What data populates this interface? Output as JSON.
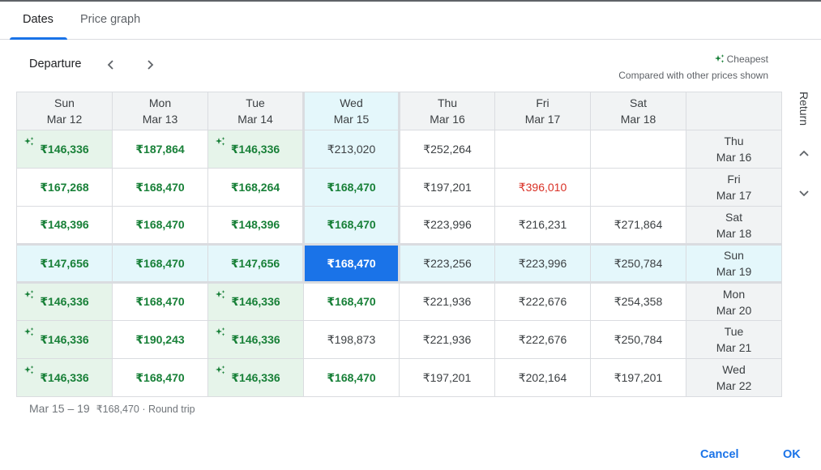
{
  "tabs": [
    {
      "label": "Dates",
      "active": true
    },
    {
      "label": "Price graph",
      "active": false
    }
  ],
  "departure_label": "Departure",
  "legend": {
    "cheapest_label": "Cheapest",
    "note": "Compared with other prices shown",
    "icon": "sparkle-icon",
    "color": "#188038"
  },
  "return_label": "Return",
  "columns": [
    {
      "day": "Sun",
      "date": "Mar 12"
    },
    {
      "day": "Mon",
      "date": "Mar 13"
    },
    {
      "day": "Tue",
      "date": "Mar 14"
    },
    {
      "day": "Wed",
      "date": "Mar 15"
    },
    {
      "day": "Thu",
      "date": "Mar 16"
    },
    {
      "day": "Fri",
      "date": "Mar 17"
    },
    {
      "day": "Sat",
      "date": "Mar 18"
    }
  ],
  "rows": [
    {
      "day": "Thu",
      "date": "Mar 16",
      "cells": [
        {
          "price": "₹146,336",
          "style": "green",
          "cheapest": true
        },
        {
          "price": "₹187,864",
          "style": "green"
        },
        {
          "price": "₹146,336",
          "style": "green",
          "cheapest": true
        },
        {
          "price": "₹213,020",
          "style": "normal"
        },
        {
          "price": "₹252,264",
          "style": "normal"
        },
        {
          "price": "",
          "style": "normal"
        },
        {
          "price": "",
          "style": "normal"
        }
      ]
    },
    {
      "day": "Fri",
      "date": "Mar 17",
      "cells": [
        {
          "price": "₹167,268",
          "style": "green"
        },
        {
          "price": "₹168,470",
          "style": "green"
        },
        {
          "price": "₹168,264",
          "style": "green"
        },
        {
          "price": "₹168,470",
          "style": "green"
        },
        {
          "price": "₹197,201",
          "style": "normal"
        },
        {
          "price": "₹396,010",
          "style": "red"
        },
        {
          "price": "",
          "style": "normal"
        }
      ]
    },
    {
      "day": "Sat",
      "date": "Mar 18",
      "cells": [
        {
          "price": "₹148,396",
          "style": "green"
        },
        {
          "price": "₹168,470",
          "style": "green"
        },
        {
          "price": "₹148,396",
          "style": "green"
        },
        {
          "price": "₹168,470",
          "style": "green"
        },
        {
          "price": "₹223,996",
          "style": "normal"
        },
        {
          "price": "₹216,231",
          "style": "normal"
        },
        {
          "price": "₹271,864",
          "style": "normal"
        }
      ]
    },
    {
      "day": "Sun",
      "date": "Mar 19",
      "cells": [
        {
          "price": "₹147,656",
          "style": "green"
        },
        {
          "price": "₹168,470",
          "style": "green"
        },
        {
          "price": "₹147,656",
          "style": "green"
        },
        {
          "price": "₹168,470",
          "style": "selected"
        },
        {
          "price": "₹223,256",
          "style": "normal"
        },
        {
          "price": "₹223,996",
          "style": "normal"
        },
        {
          "price": "₹250,784",
          "style": "normal"
        }
      ]
    },
    {
      "day": "Mon",
      "date": "Mar 20",
      "cells": [
        {
          "price": "₹146,336",
          "style": "green",
          "cheapest": true
        },
        {
          "price": "₹168,470",
          "style": "green"
        },
        {
          "price": "₹146,336",
          "style": "green",
          "cheapest": true
        },
        {
          "price": "₹168,470",
          "style": "green"
        },
        {
          "price": "₹221,936",
          "style": "normal"
        },
        {
          "price": "₹222,676",
          "style": "normal"
        },
        {
          "price": "₹254,358",
          "style": "normal"
        }
      ]
    },
    {
      "day": "Tue",
      "date": "Mar 21",
      "cells": [
        {
          "price": "₹146,336",
          "style": "green",
          "cheapest": true
        },
        {
          "price": "₹190,243",
          "style": "green"
        },
        {
          "price": "₹146,336",
          "style": "green",
          "cheapest": true
        },
        {
          "price": "₹198,873",
          "style": "normal"
        },
        {
          "price": "₹221,936",
          "style": "normal"
        },
        {
          "price": "₹222,676",
          "style": "normal"
        },
        {
          "price": "₹250,784",
          "style": "normal"
        }
      ]
    },
    {
      "day": "Wed",
      "date": "Mar 22",
      "cells": [
        {
          "price": "₹146,336",
          "style": "green",
          "cheapest": true
        },
        {
          "price": "₹168,470",
          "style": "green"
        },
        {
          "price": "₹146,336",
          "style": "green",
          "cheapest": true
        },
        {
          "price": "₹168,470",
          "style": "green"
        },
        {
          "price": "₹197,201",
          "style": "normal"
        },
        {
          "price": "₹202,164",
          "style": "normal"
        },
        {
          "price": "₹197,201",
          "style": "normal"
        }
      ]
    }
  ],
  "selection": {
    "column_index": 3,
    "row_index": 3
  },
  "summary": {
    "dates": "Mar 15 – 19",
    "price": "₹168,470 · Round trip"
  },
  "buttons": {
    "cancel": "Cancel",
    "ok": "OK"
  },
  "colors": {
    "accent": "#1a73e8",
    "cheap_green": "#188038",
    "cheap_bg": "#e6f4ea",
    "expensive_red": "#d93025",
    "selected_band": "#e4f7fb",
    "header_bg": "#f1f3f4"
  }
}
